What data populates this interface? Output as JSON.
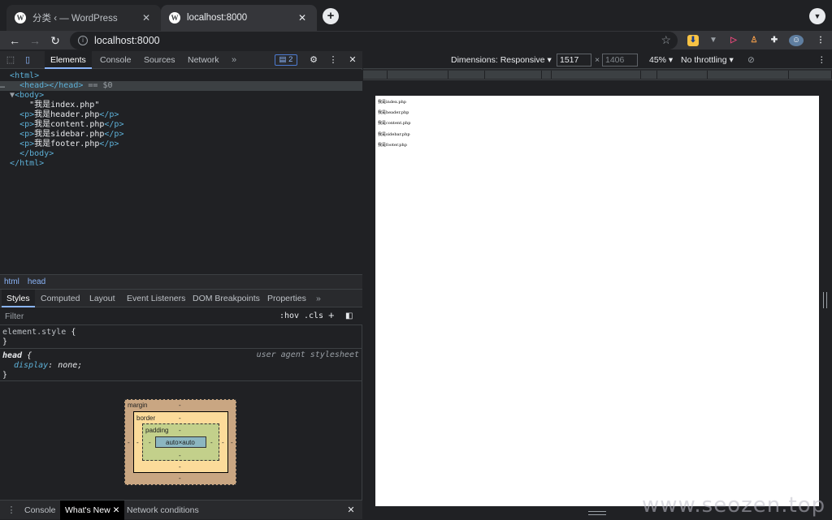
{
  "browser": {
    "tabs": [
      {
        "title": "分类 ‹ — WordPress",
        "icon": "wordpress-icon"
      },
      {
        "title": "localhost:8000",
        "icon": "wordpress-icon"
      }
    ],
    "url": "localhost:8000"
  },
  "devtools": {
    "main_tabs": [
      "Elements",
      "Console",
      "Sources",
      "Network"
    ],
    "issues_count": "2",
    "dom": {
      "html_open": "<html>",
      "head": "<head></head>",
      "head_marker": "== $0",
      "body_open": "<body>",
      "text_node": "\"我是index.php\"",
      "p_lines": [
        "header.php",
        "content.php",
        "sidebar.php",
        "footer.php"
      ],
      "p_prefix": "我是",
      "body_close": "</body>",
      "html_close": "</html>"
    },
    "breadcrumbs": [
      "html",
      "head"
    ],
    "sub_tabs": [
      "Styles",
      "Computed",
      "Layout",
      "Event Listeners",
      "DOM Breakpoints",
      "Properties"
    ],
    "filter_placeholder": "Filter",
    "hov": ":hov",
    "cls": ".cls",
    "rules": {
      "element_style": "element.style",
      "head_selector": "head",
      "head_source": "user agent stylesheet",
      "prop_name": "display",
      "prop_value": "none"
    },
    "box_model": {
      "margin": "margin",
      "border": "border",
      "padding": "padding",
      "content": "auto×auto",
      "dash": "-"
    },
    "drawer_tabs": [
      "Console",
      "What's New",
      "Network conditions"
    ]
  },
  "device_toolbar": {
    "dimensions": "Dimensions: Responsive",
    "width": "1517",
    "height": "1406",
    "zoom": "45%",
    "throttling": "No throttling"
  },
  "page_content": [
    "我是index.php",
    "我是header.php",
    "我是content.php",
    "我是sidebar.php",
    "我是footer.php"
  ],
  "watermark": "www.seozen.top"
}
